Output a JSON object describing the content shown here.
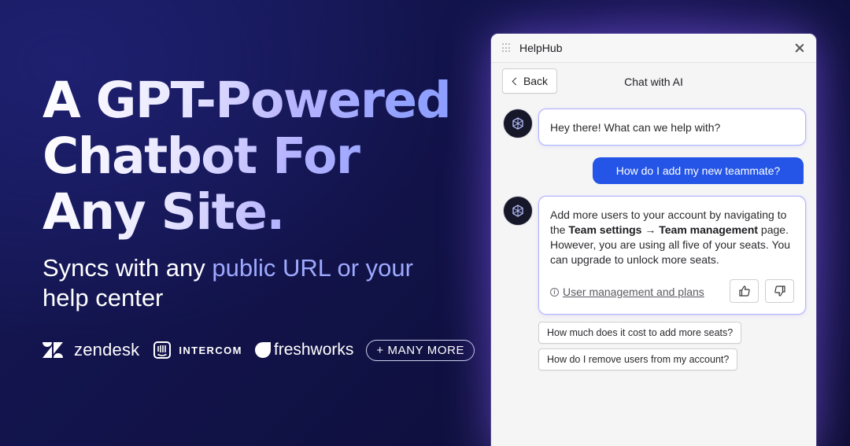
{
  "hero": {
    "line1": "A GPT-Powered",
    "line2": "Chatbot For",
    "line3": "Any Site.",
    "subtitle_part1": "Syncs with any ",
    "subtitle_highlight": "public URL or your",
    "subtitle_part2": "help center"
  },
  "logos": {
    "zendesk": "zendesk",
    "intercom": "INTERCOM",
    "freshworks": "freshworks",
    "more": "+ MANY MORE"
  },
  "widget": {
    "app_title": "HelpHub",
    "back_label": "Back",
    "chat_title": "Chat with AI",
    "messages": {
      "greeting": "Hey there! What can we help with?",
      "user_question": "How do I add my new teammate?",
      "answer_part1": "Add more users to your account by navigating to the ",
      "answer_bold1": "Team settings",
      "answer_arrow": " → ",
      "answer_bold2": "Team management",
      "answer_part2": " page. However, you are using all five of your seats. You can upgrade to unlock more seats.",
      "source_label": "User management and plans"
    },
    "suggestions": [
      "How much does it cost to add more seats?",
      "How do I remove users from my account?"
    ]
  },
  "colors": {
    "user_bubble": "#2455e6",
    "bot_border": "#b4b5ff",
    "accent_text": "#9ea9ff"
  }
}
